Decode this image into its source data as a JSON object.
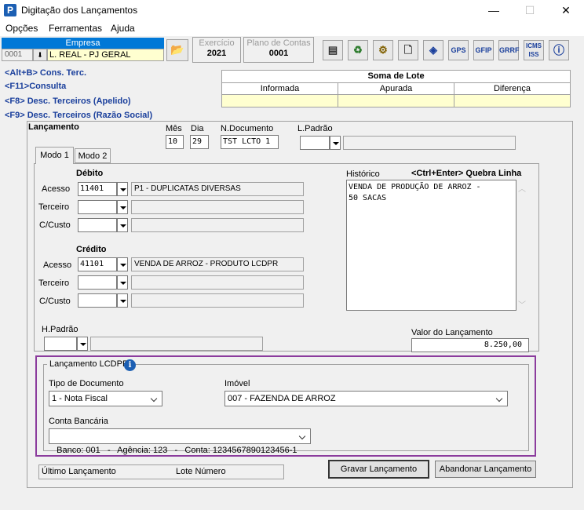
{
  "window": {
    "title": "Digitação dos Lançamentos",
    "minimize": "—",
    "maximize": "☐",
    "close": "✕"
  },
  "menu": [
    "Opções",
    "Ferramentas",
    "Ajuda"
  ],
  "empresa": {
    "label": "Empresa",
    "code": "0001",
    "name": "L. REAL - PJ GERAL"
  },
  "exercicio": {
    "label": "Exercício",
    "value": "2021"
  },
  "plano": {
    "label": "Plano de Contas",
    "value": "0001"
  },
  "toolbar": [
    "gps_label",
    "gfip_label",
    "grrf_label",
    "icms_label"
  ],
  "toolbar_labels": {
    "gps_label": "GPS",
    "gfip_label": "GFIP",
    "grrf_label": "GRRF",
    "icms_label": "ICMS ISS"
  },
  "shortcuts": [
    "<Alt+B> Cons. Terc.",
    "<F11>Consulta",
    "<F8> Desc. Terceiros (Apelido)",
    "<F9> Desc. Terceiros (Razão Social)"
  ],
  "soma_lote": {
    "title": "Soma de Lote",
    "cols": [
      "Informada",
      "Apurada",
      "Diferença"
    ]
  },
  "lancamento": {
    "section": "Lançamento",
    "mes_label": "Mês",
    "mes": "10",
    "dia_label": "Dia",
    "dia": "29",
    "ndoc_label": "N.Documento",
    "ndoc": "TST LCTO 1",
    "lpadrao_label": "L.Padrão"
  },
  "tabs": [
    "Modo 1",
    "Modo 2"
  ],
  "debito": {
    "title": "Débito",
    "acesso_label": "Acesso",
    "acesso": "11401",
    "acesso_desc": "P1 - DUPLICATAS DIVERSAS",
    "terceiro_label": "Terceiro",
    "ccusto_label": "C/Custo"
  },
  "credito": {
    "title": "Crédito",
    "acesso_label": "Acesso",
    "acesso": "41101",
    "acesso_desc": "VENDA DE ARROZ - PRODUTO LCDPR",
    "terceiro_label": "Terceiro",
    "ccusto_label": "C/Custo"
  },
  "historico": {
    "label": "Histórico",
    "hint": "<Ctrl+Enter> Quebra Linha",
    "line1": "VENDA DE PRODUÇÃO DE ARROZ -",
    "line2": "50 SACAS"
  },
  "hpadrao_label": "H.Padrão",
  "valor": {
    "label": "Valor do Lançamento",
    "value": "8.250,00"
  },
  "lcdpr": {
    "title": "Lançamento LCDPR",
    "tipo_label": "Tipo de Documento",
    "tipo": "1 - Nota Fiscal",
    "imovel_label": "Imóvel",
    "imovel": "007 - FAZENDA DE ARROZ",
    "conta_label": "Conta Bancária",
    "conta": "Banco: 001   -   Agência: 123   -   Conta: 1234567890123456-1"
  },
  "footer": {
    "ultimo_label": "Último Lançamento",
    "lote_label": "Lote Número",
    "gravar": "Gravar Lançamento",
    "abandonar": "Abandonar Lançamento"
  }
}
